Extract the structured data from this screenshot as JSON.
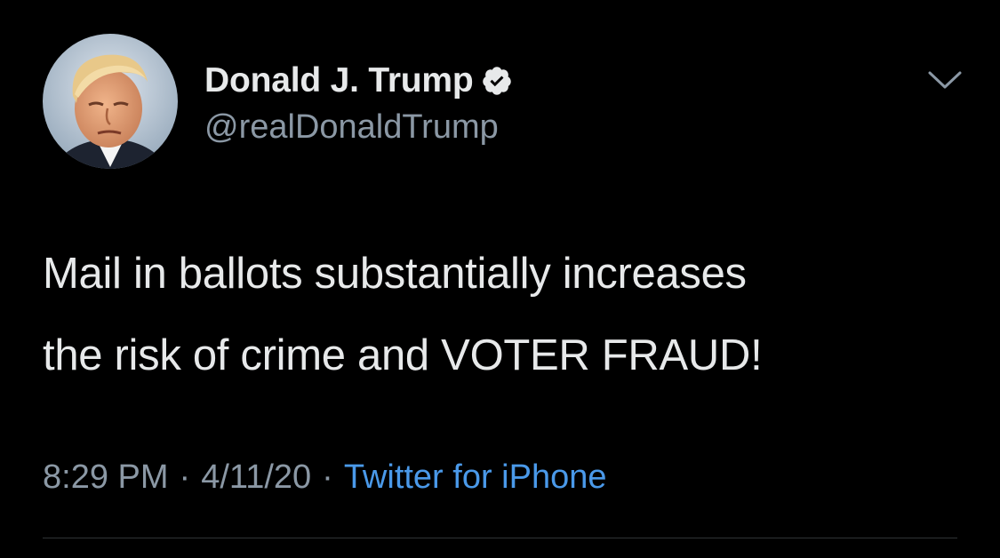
{
  "author": {
    "display_name": "Donald J. Trump",
    "handle": "@realDonaldTrump",
    "verified": true,
    "avatar_icon": "profile-photo"
  },
  "tweet": {
    "text_lines": [
      "Mail in ballots substantially increases",
      "the risk of crime and VOTER FRAUD!"
    ],
    "time": "8:29 PM",
    "date": "4/11/20",
    "separator": "·",
    "source": "Twitter for iPhone"
  },
  "colors": {
    "background": "#000000",
    "primary_text": "#e7e9ea",
    "secondary_text": "#8b98a5",
    "link": "#4a99e9",
    "verified_badge": "#e7e9ea"
  },
  "icons": {
    "menu": "chevron-down-icon",
    "badge": "verified-badge-icon"
  }
}
